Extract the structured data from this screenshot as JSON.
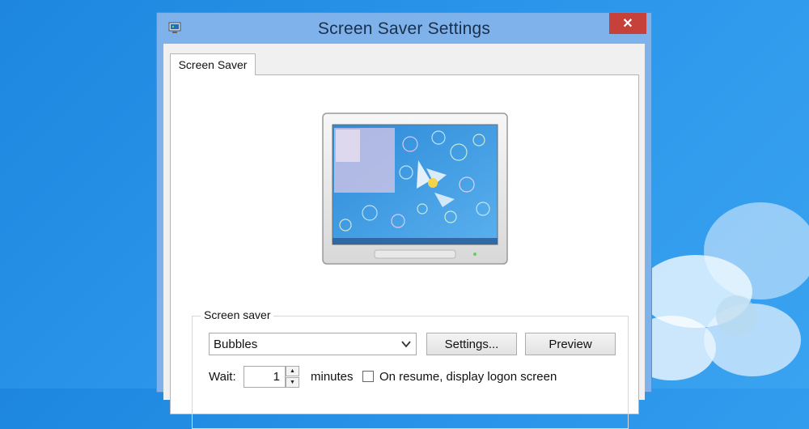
{
  "window": {
    "title": "Screen Saver Settings",
    "close_symbol": "✕"
  },
  "tabs": [
    {
      "label": "Screen Saver",
      "active": true
    }
  ],
  "screen_saver_group": {
    "legend": "Screen saver",
    "selected": "Bubbles",
    "settings_button": "Settings...",
    "preview_button": "Preview",
    "wait_label": "Wait:",
    "wait_value": "1",
    "minutes_label": "minutes",
    "resume_label": "On resume, display logon screen",
    "resume_checked": false
  },
  "icons": {
    "app": "screen-saver-icon",
    "close": "close-icon",
    "dropdown": "chevron-down-icon",
    "spin_up": "spin-up-icon",
    "spin_down": "spin-down-icon"
  },
  "colors": {
    "desktop": "#2a95ea",
    "title_bar": "#7fb2ea",
    "close": "#c7413b",
    "client": "#f0f0f0"
  }
}
